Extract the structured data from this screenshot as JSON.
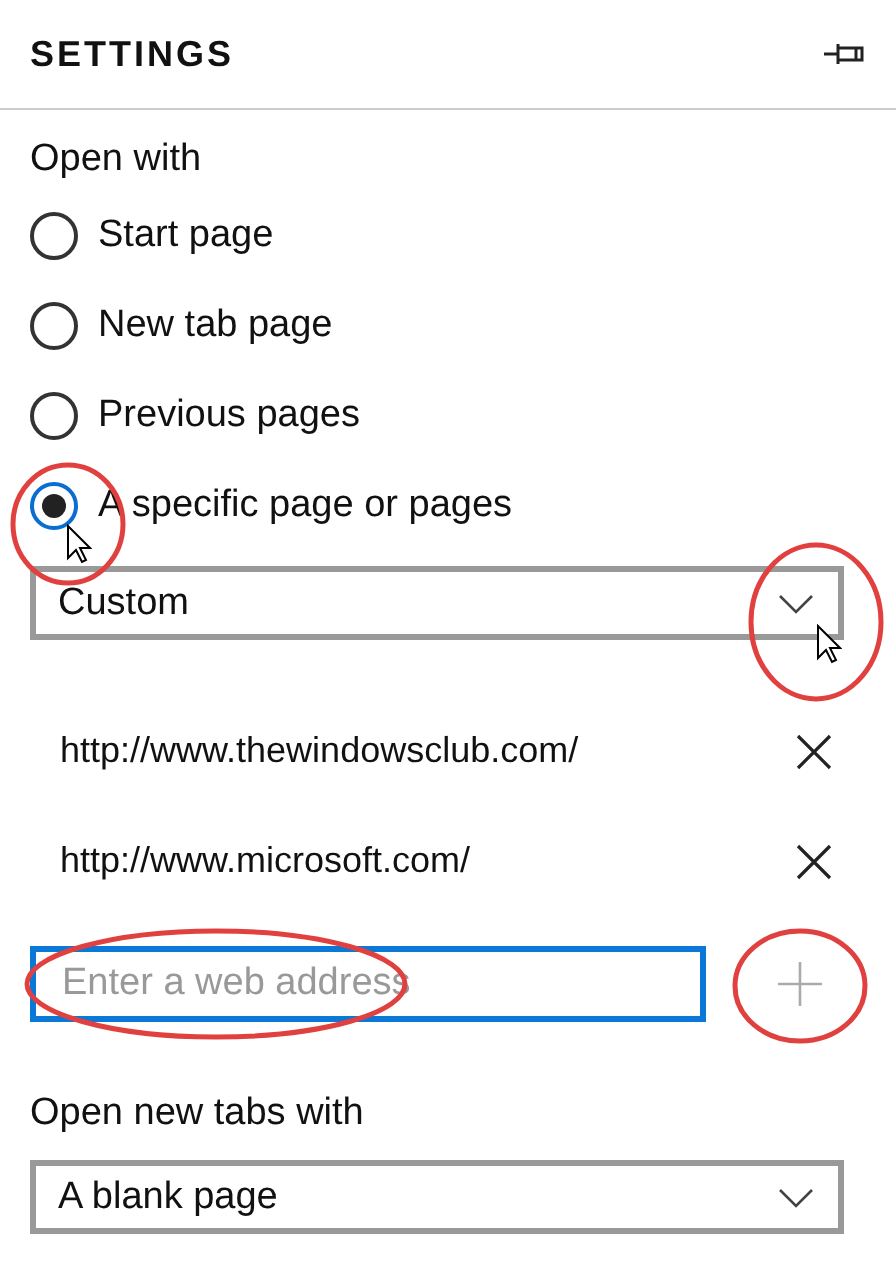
{
  "panel": {
    "title": "SETTINGS"
  },
  "open_with": {
    "label": "Open with",
    "options": [
      {
        "label": "Start page",
        "selected": false
      },
      {
        "label": "New tab page",
        "selected": false
      },
      {
        "label": "Previous pages",
        "selected": false
      },
      {
        "label": "A specific page or pages",
        "selected": true
      }
    ],
    "dropdown": {
      "value": "Custom"
    },
    "pages": [
      {
        "url": "http://www.thewindowsclub.com/"
      },
      {
        "url": "http://www.microsoft.com/"
      }
    ],
    "address_field": {
      "placeholder": "Enter a web address"
    }
  },
  "new_tabs": {
    "label": "Open new tabs with",
    "dropdown": {
      "value": "A blank page"
    }
  }
}
